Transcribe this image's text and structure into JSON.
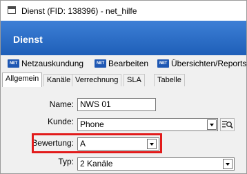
{
  "window": {
    "title": "Dienst (FID: 138396) - net_hilfe"
  },
  "header": {
    "title": "Dienst"
  },
  "toolbar": {
    "items": [
      {
        "label": "Netzauskundung",
        "icon": "net-icon"
      },
      {
        "label": "Bearbeiten",
        "icon": "net-icon"
      },
      {
        "label": "Übersichten/Reports",
        "icon": "net-icon"
      }
    ],
    "icon_text": "NET"
  },
  "tabs": [
    {
      "label": "Allgemein",
      "active": true
    },
    {
      "label": "Kanäle",
      "active": false
    },
    {
      "label": "Verrechnung",
      "active": false
    },
    {
      "label": "SLA",
      "active": false
    },
    {
      "label": "Tabelle",
      "active": false
    }
  ],
  "form": {
    "name": {
      "label": "Name:",
      "value": "NWS 01"
    },
    "kunde": {
      "label": "Kunde:",
      "value": "Phone"
    },
    "bewertung": {
      "label": "Bewertung:",
      "value": "A"
    },
    "typ": {
      "label": "Typ:",
      "value": "2 Kanäle"
    }
  },
  "colors": {
    "header_blue": "#1e5fb8",
    "highlight_red": "#e21b1b",
    "net_icon_blue": "#1e57b3"
  }
}
